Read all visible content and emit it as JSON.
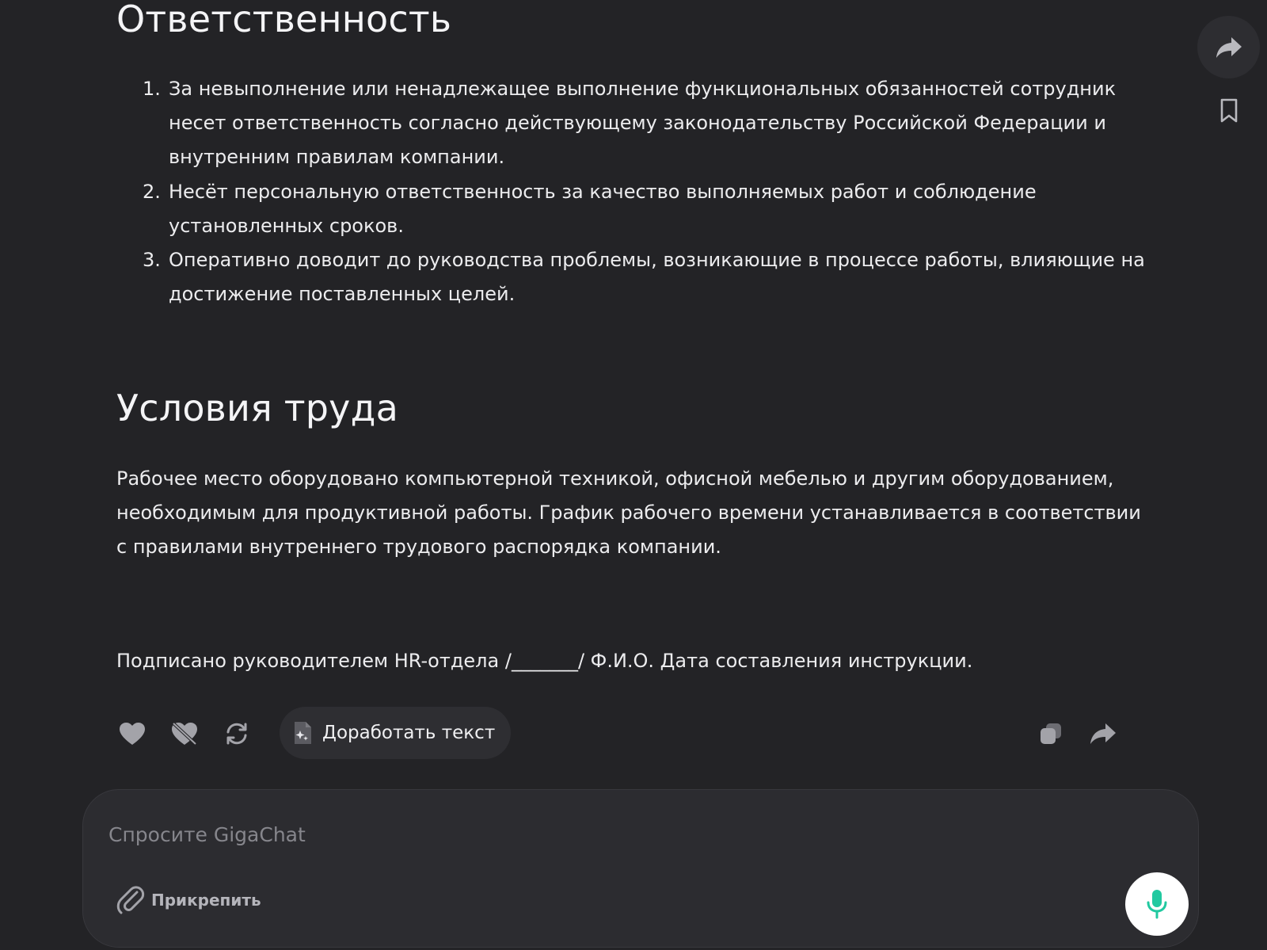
{
  "sections": {
    "responsibility": {
      "title": "Ответственность",
      "items": [
        {
          "num": "1.",
          "text": "За невыполнение или ненадлежащее выполнение функциональных обязанностей сотрудник несет ответственность согласно действующему законодательству Российской Федерации и внутренним правилам компании."
        },
        {
          "num": "2.",
          "text": "Несёт персональную ответственность за качество выполняемых работ и соблюдение установленных сроков."
        },
        {
          "num": "3.",
          "text": "Оперативно доводит до руководства проблемы, возникающие в процессе работы, влияющие на достижение поставленных целей."
        }
      ]
    },
    "conditions": {
      "title": "Условия труда",
      "text": "Рабочее место оборудовано компьютерной техникой, офисной мебелью и другим оборудованием, необходимым для продуктивной работы. График рабочего времени устанавливается в соответствии с правилами внутреннего трудового распорядка компании."
    },
    "signature": {
      "text": "Подписано руководителем HR-отдела /_______/ Ф.И.О. Дата составления инструкции."
    }
  },
  "actions": {
    "improve_label": "Доработать текст"
  },
  "composer": {
    "placeholder": "Спросите GigaChat",
    "attach_label": "Прикрепить"
  },
  "icons": {
    "like": "heart-icon",
    "dislike": "heart-off-icon",
    "regenerate": "refresh-icon",
    "improve": "sparkle-doc-icon",
    "copy": "copy-icon",
    "share": "share-arrow-icon",
    "bookmark": "bookmark-icon",
    "attach": "paperclip-icon",
    "mic": "microphone-icon"
  },
  "colors": {
    "background": "#232326",
    "text": "#ececee",
    "mic_accent": "#21c9a0",
    "icon_gray": "#9a9aa0"
  }
}
